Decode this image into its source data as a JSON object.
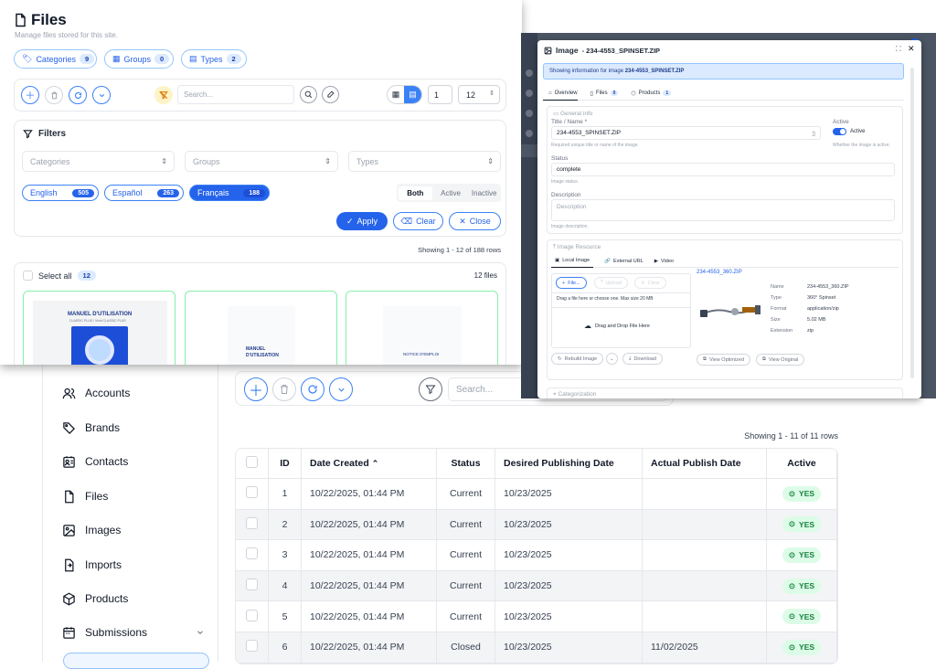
{
  "back": {
    "sidebar": [
      {
        "label": "Accounts",
        "icon": "users-icon"
      },
      {
        "label": "Brands",
        "icon": "tag-icon"
      },
      {
        "label": "Contacts",
        "icon": "contact-card-icon"
      },
      {
        "label": "Files",
        "icon": "file-icon"
      },
      {
        "label": "Images",
        "icon": "image-icon"
      },
      {
        "label": "Imports",
        "icon": "import-icon"
      },
      {
        "label": "Products",
        "icon": "cube-icon"
      },
      {
        "label": "Submissions",
        "icon": "calendar-icon"
      }
    ],
    "search_placeholder": "Search...",
    "showing": "Showing 1 - 11 of 11 rows",
    "columns": [
      "ID",
      "Date Created",
      "Status",
      "Desired Publishing Date",
      "Actual Publish Date",
      "Active"
    ],
    "rows": [
      {
        "id": "1",
        "created": "10/22/2025, 01:44 PM",
        "status": "Current",
        "desired": "10/23/2025",
        "actual": "",
        "active": "YES"
      },
      {
        "id": "2",
        "created": "10/22/2025, 01:44 PM",
        "status": "Current",
        "desired": "10/23/2025",
        "actual": "",
        "active": "YES"
      },
      {
        "id": "3",
        "created": "10/22/2025, 01:44 PM",
        "status": "Current",
        "desired": "10/23/2025",
        "actual": "",
        "active": "YES"
      },
      {
        "id": "4",
        "created": "10/22/2025, 01:44 PM",
        "status": "Current",
        "desired": "10/23/2025",
        "actual": "",
        "active": "YES"
      },
      {
        "id": "5",
        "created": "10/22/2025, 01:44 PM",
        "status": "Current",
        "desired": "10/23/2025",
        "actual": "",
        "active": "YES"
      },
      {
        "id": "6",
        "created": "10/22/2025, 01:44 PM",
        "status": "Closed",
        "desired": "10/23/2025",
        "actual": "11/02/2025",
        "active": "YES"
      }
    ]
  },
  "files": {
    "title": "Files",
    "subtitle": "Manage files stored for this site.",
    "pills": [
      {
        "label": "Categories",
        "count": "9"
      },
      {
        "label": "Groups",
        "count": "0"
      },
      {
        "label": "Types",
        "count": "2"
      }
    ],
    "search_placeholder": "Search...",
    "page": "1",
    "per_page": "12",
    "filters_title": "Filters",
    "selects": [
      "Categories",
      "Groups",
      "Types"
    ],
    "langs": [
      {
        "label": "English",
        "count": "505"
      },
      {
        "label": "Español",
        "count": "263"
      },
      {
        "label": "Français",
        "count": "188"
      }
    ],
    "seg": [
      "Both",
      "Active",
      "Inactive"
    ],
    "apply": "Apply",
    "clear": "Clear",
    "close": "Close",
    "showing": "Showing 1 - 12 of 188 rows",
    "select_all": "Select all",
    "select_count": "12",
    "files_count": "12 files",
    "thumbs": [
      "MANUEL D'UTILISATION",
      "MANUEL D'UTILISATION",
      "NOTICE D'EMPLOI"
    ],
    "thumb_sub": "CLASSIC PLUS / Vivid CLASSIC PLUS"
  },
  "modal": {
    "title": "Image",
    "title_name": "- 234-4553_SPINSET.ZIP",
    "info_prefix": "Showing information for image ",
    "info_name": "234-4553_SPINSET.ZIP",
    "tabs": [
      {
        "label": "Overview"
      },
      {
        "label": "Files",
        "count": "0"
      },
      {
        "label": "Products",
        "count": "1"
      }
    ],
    "general": "General info",
    "title_label": "Title / Name *",
    "title_value": "234-4553_SPINSET.ZIP",
    "title_help": "Required unique title or name of the image.",
    "active_label": "Active",
    "active_toggle": "Active",
    "active_help": "Whether the image is active.",
    "status_label": "Status",
    "status_value": "complete",
    "status_help": "Image status.",
    "desc_label": "Description",
    "desc_placeholder": "Description",
    "desc_help": "Image description.",
    "resource": "Image Resource",
    "res_tabs": [
      "Local Image",
      "External URL",
      "Video"
    ],
    "file_btn": "File...",
    "upload_btn": "Upload",
    "clear_btn": "Clear",
    "drop_help": "Drag a file here or choose one. Max size 20 MB",
    "drop_text": "Drag and Drop File Here",
    "rebuild": "Rebuild Image",
    "download": "Download",
    "link": "234-4553_360.ZIP",
    "meta": [
      [
        "Name",
        "234-4553_360.ZIP"
      ],
      [
        "Type",
        "360° Spinset"
      ],
      [
        "Format",
        "application/zip"
      ],
      [
        "Size",
        "5.02 MB"
      ],
      [
        "Extension",
        "zip"
      ]
    ],
    "view_opt": "View Optimized",
    "view_orig": "View Original",
    "categorization": "Categorization"
  },
  "colors": {
    "accent": "#2563eb",
    "active_green": "#15803d",
    "success_bg": "#dcfce7"
  }
}
